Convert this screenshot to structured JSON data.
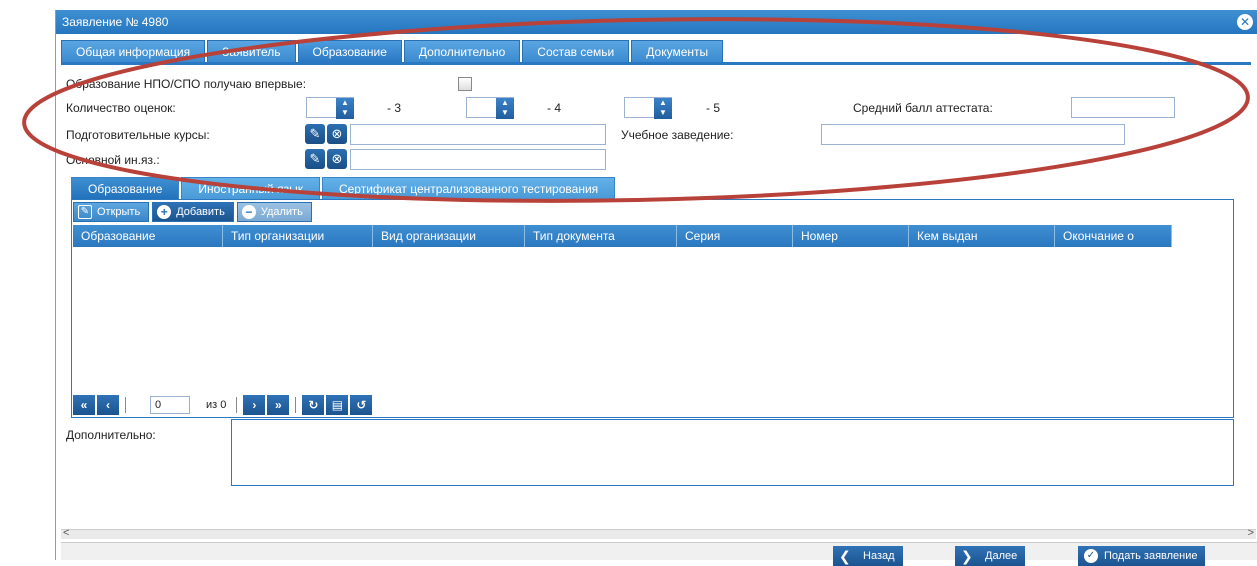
{
  "window": {
    "title": "Заявление № 4980"
  },
  "main_tabs": [
    {
      "label": "Общая информация"
    },
    {
      "label": "Заявитель"
    },
    {
      "label": "Образование"
    },
    {
      "label": "Дополнительно"
    },
    {
      "label": "Состав семьи"
    },
    {
      "label": "Документы"
    }
  ],
  "form": {
    "first_time_label": "Образование НПО/СПО получаю впервые:",
    "grades_label": "Количество оценок:",
    "grade3_suffix": "- 3",
    "grade4_suffix": "- 4",
    "grade5_suffix": "- 5",
    "avg_label": "Средний балл аттестата:",
    "courses_label": "Подготовительные курсы:",
    "institution_label": "Учебное заведение:",
    "language_label": "Основной ин.яз.:"
  },
  "sub_tabs": [
    {
      "label": "Образование"
    },
    {
      "label": "Иностранный язык"
    },
    {
      "label": "Сертификат централизованного тестирования"
    }
  ],
  "toolbar": {
    "open_label": "Открыть",
    "add_label": "Добавить",
    "delete_label": "Удалить"
  },
  "grid": {
    "columns": [
      "Образование",
      "Тип организации",
      "Вид организации",
      "Тип документа",
      "Серия",
      "Номер",
      "Кем выдан",
      "Окончание о"
    ]
  },
  "pager": {
    "page_value": "0",
    "of_text": "из 0"
  },
  "additional_label": "Дополнительно:",
  "footer": {
    "back_label": "Назад",
    "next_label": "Далее",
    "submit_label": "Подать заявление"
  },
  "colors": {
    "accent": "#2b78c2",
    "annotation": "#b8413a"
  }
}
